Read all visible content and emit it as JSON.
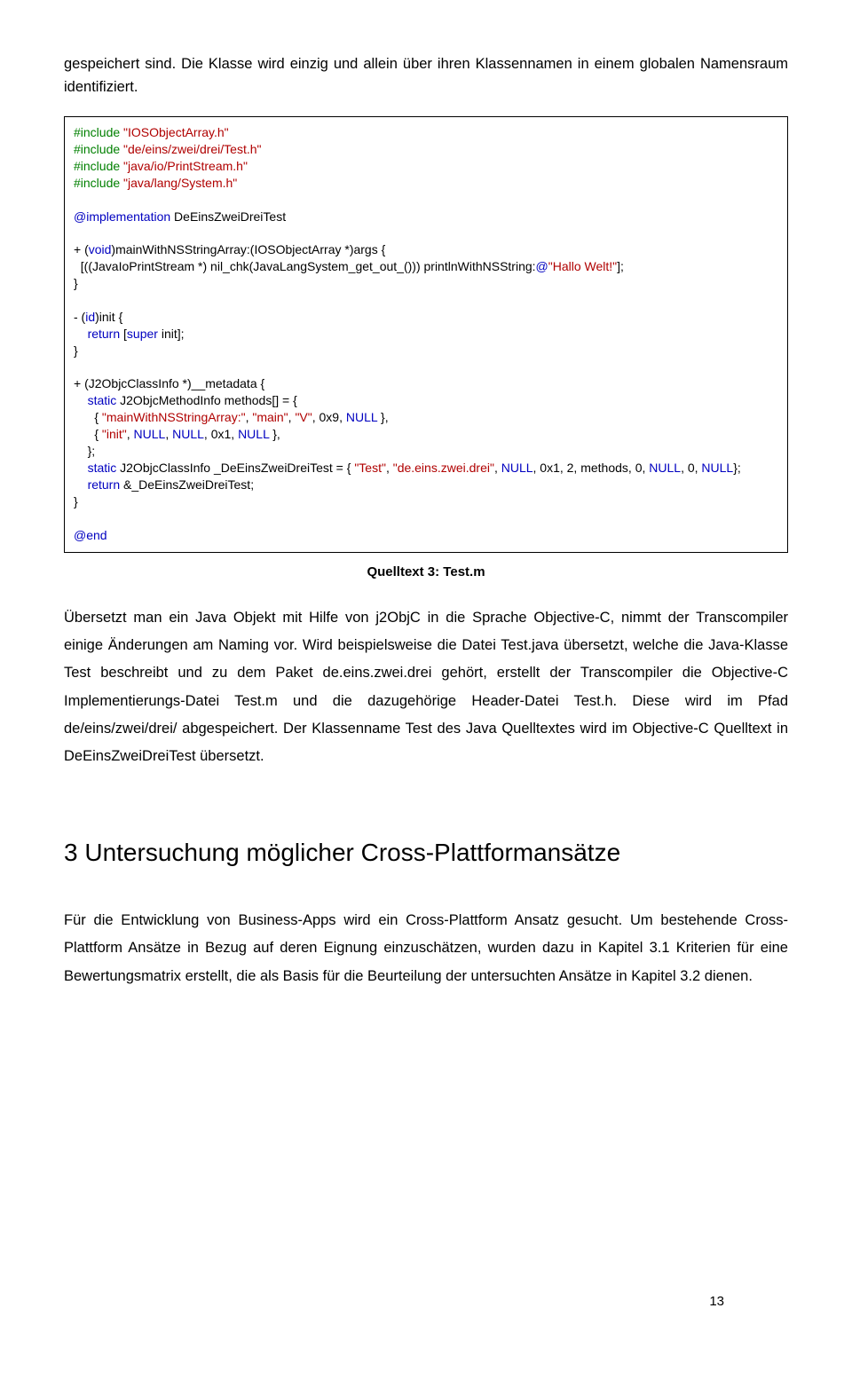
{
  "intro": "gespeichert sind. Die Klasse wird einzig und allein über ihren Klassennamen in einem globalen Namensraum identifiziert.",
  "code": {
    "line1_a": "#include",
    "line1_b": " \"IOSObjectArray.h\"",
    "line2_a": "#include",
    "line2_b": " \"de/eins/zwei/drei/Test.h\"",
    "line3_a": "#include",
    "line3_b": " \"java/io/PrintStream.h\"",
    "line4_a": "#include",
    "line4_b": " \"java/lang/System.h\"",
    "blank1": "",
    "impl_a": "@implementation",
    "impl_b": " DeEinsZweiDreiTest",
    "blank2": "",
    "m1_a": "+ (",
    "m1_b": "void",
    "m1_c": ")mainWithNSStringArray:(IOSObjectArray *)args {",
    "m1_body_a": "  [((JavaIoPrintStream *) nil_chk(JavaLangSystem_get_out_())) printlnWithNSString:",
    "m1_body_at": "@",
    "m1_body_str": "\"Hallo Welt!\"",
    "m1_body_end": "];",
    "brace1": "}",
    "blank3": "",
    "m2_a": "- (",
    "m2_b": "id",
    "m2_c": ")init {",
    "m2_body_a": "    ",
    "m2_body_ret": "return",
    "m2_body_b": " [",
    "m2_body_super": "super",
    "m2_body_c": " init];",
    "brace2": "}",
    "blank4": "",
    "m3_a": "+ (J2ObjcClassInfo *)__metadata {",
    "m3_l1_a": "    ",
    "m3_l1_static": "static",
    "m3_l1_b": " J2ObjcMethodInfo methods[] = {",
    "m3_l2_a": "      { ",
    "m3_l2_s1": "\"mainWithNSStringArray:\"",
    "m3_l2_b": ", ",
    "m3_l2_s2": "\"main\"",
    "m3_l2_c": ", ",
    "m3_l2_s3": "\"V\"",
    "m3_l2_d": ", 0x9, ",
    "m3_l2_null": "NULL",
    "m3_l2_e": " },",
    "m3_l3_a": "      { ",
    "m3_l3_s1": "\"init\"",
    "m3_l3_b": ", ",
    "m3_l3_null1": "NULL",
    "m3_l3_c": ", ",
    "m3_l3_null2": "NULL",
    "m3_l3_d": ", 0x1, ",
    "m3_l3_null3": "NULL",
    "m3_l3_e": " },",
    "m3_l4": "    };",
    "m3_l5_a": "    ",
    "m3_l5_static": "static",
    "m3_l5_b": " J2ObjcClassInfo _DeEinsZweiDreiTest = { ",
    "m3_l5_s1": "\"Test\"",
    "m3_l5_c": ", ",
    "m3_l5_s2": "\"de.eins.zwei.drei\"",
    "m3_l5_d": ", ",
    "m3_l5_null1": "NULL",
    "m3_l5_e": ", 0x1, 2, methods, 0, ",
    "m3_l6_null1": "NULL",
    "m3_l6_a": ", 0, ",
    "m3_l6_null2": "NULL",
    "m3_l6_b": "};",
    "m3_l7_a": "    ",
    "m3_l7_ret": "return",
    "m3_l7_b": " &_DeEinsZweiDreiTest;",
    "brace3": "}",
    "blank5": "",
    "end": "@end"
  },
  "caption": "Quelltext 3: Test.m",
  "para1": "Übersetzt man ein Java Objekt mit Hilfe von j2ObjC in die Sprache Objective-C, nimmt der Transcompiler einige Änderungen am Naming vor. Wird beispielsweise die Datei Test.java übersetzt, welche die Java-Klasse Test beschreibt und zu dem Paket de.eins.zwei.drei gehört, erstellt der Transcompiler die Objective-C Implementierungs-Datei Test.m und die dazugehörige Header-Datei Test.h. Diese wird im Pfad de/eins/zwei/drei/ abgespeichert. Der Klassenname Test des Java Quelltextes wird im Objective-C Quelltext in DeEinsZweiDreiTest übersetzt.",
  "heading": "3   Untersuchung möglicher Cross-Plattformansätze",
  "para2": "Für die Entwicklung von Business-Apps wird ein Cross-Plattform Ansatz gesucht. Um bestehende Cross-Plattform Ansätze in Bezug auf deren Eignung einzuschätzen, wurden dazu in Kapitel 3.1 Kriterien für eine Bewertungsmatrix erstellt, die als Basis für die Beurteilung der untersuchten Ansätze in Kapitel 3.2 dienen.",
  "page_number": "13"
}
